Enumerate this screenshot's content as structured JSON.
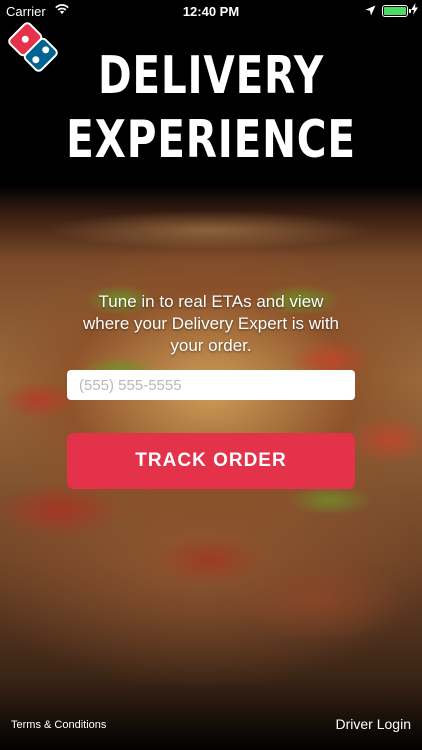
{
  "status_bar": {
    "carrier": "Carrier",
    "time": "12:40 PM",
    "wifi_icon": "wifi-icon",
    "location_icon": "location-arrow-icon",
    "battery_icon": "battery-icon",
    "battery_color": "#4cd964"
  },
  "brand": {
    "logo_icon": "dominos-domino-logo",
    "logo_red": "#e3324a",
    "logo_blue": "#006491"
  },
  "hero": {
    "title_line1": "DELIVERY",
    "title_line2": "EXPERIENCE",
    "tagline": "Tune in to real ETAs and view where your Delivery Expert is with your order."
  },
  "form": {
    "phone_placeholder": "(555) 555-5555",
    "phone_value": "",
    "track_button_label": "TRACK ORDER",
    "button_color": "#e3324a"
  },
  "footer": {
    "terms_label": "Terms & Conditions",
    "driver_login_label": "Driver Login"
  }
}
